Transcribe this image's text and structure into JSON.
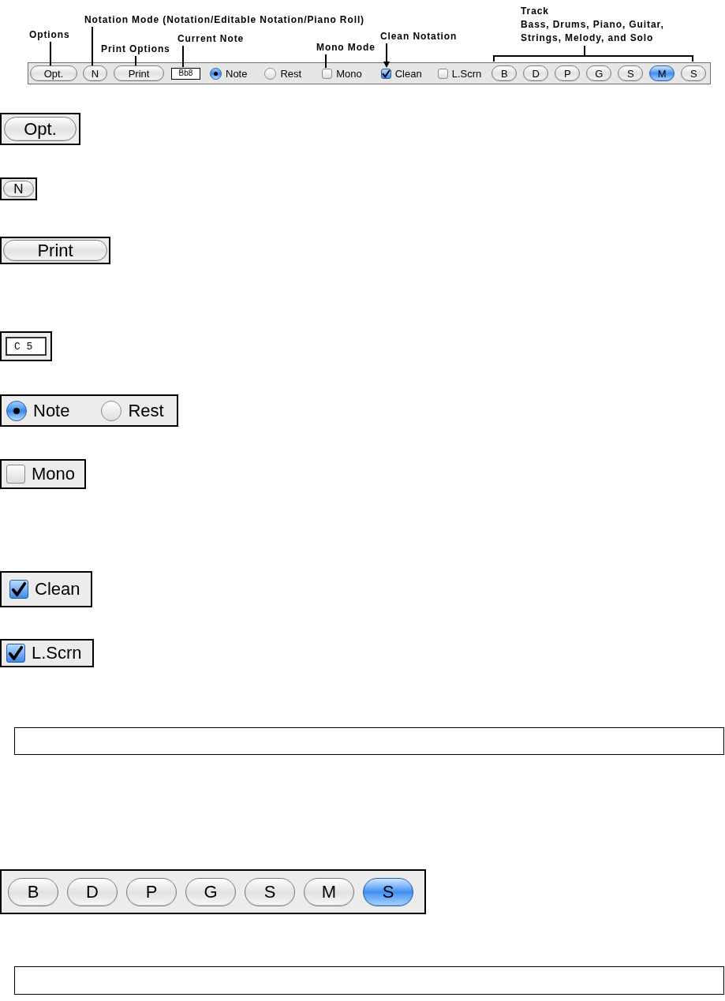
{
  "callouts": [
    {
      "kind": "line",
      "text": "Options"
    },
    {
      "kind": "line",
      "text": "Notation Mode (Notation/Editable Notation/Piano Roll)"
    },
    {
      "kind": "line",
      "text": "Print Options"
    },
    {
      "kind": "line",
      "text": "Current Note"
    },
    {
      "kind": "line",
      "text": "Mono Mode"
    },
    {
      "kind": "arrow",
      "text": "Clean Notation"
    },
    {
      "kind": "bracket",
      "lines": [
        "Track",
        "Bass, Drums, Piano, Guitar,",
        "Strings, Melody, and Solo"
      ]
    }
  ],
  "toolbar": {
    "items": [
      {
        "kind": "button",
        "label": "Opt."
      },
      {
        "kind": "button",
        "label": "N"
      },
      {
        "kind": "button",
        "label": "Print"
      },
      {
        "kind": "field",
        "value": "Bb8"
      },
      {
        "kind": "radio",
        "label": "Note",
        "selected": true
      },
      {
        "kind": "radio",
        "label": "Rest",
        "selected": false
      },
      {
        "kind": "checkbox",
        "label": "Mono",
        "checked": false
      },
      {
        "kind": "checkbox",
        "label": "Clean",
        "checked": true
      },
      {
        "kind": "checkbox",
        "label": "L.Scrn",
        "checked": false
      },
      {
        "kind": "track",
        "label": "B",
        "selected": false
      },
      {
        "kind": "track",
        "label": "D",
        "selected": false
      },
      {
        "kind": "track",
        "label": "P",
        "selected": false
      },
      {
        "kind": "track",
        "label": "G",
        "selected": false
      },
      {
        "kind": "track",
        "label": "S",
        "selected": false
      },
      {
        "kind": "track",
        "label": "M",
        "selected": true
      },
      {
        "kind": "track",
        "label": "S",
        "selected": false
      }
    ]
  },
  "details": [
    {
      "kind": "button",
      "label": "Opt."
    },
    {
      "kind": "button",
      "label": "N"
    },
    {
      "kind": "button",
      "label": "Print"
    },
    {
      "kind": "field",
      "value": "C 5"
    },
    {
      "kind": "radios",
      "options": [
        {
          "label": "Note",
          "selected": true
        },
        {
          "label": "Rest",
          "selected": false
        }
      ]
    },
    {
      "kind": "checkbox",
      "label": "Mono",
      "checked": false
    },
    {
      "kind": "checkbox",
      "label": "Clean",
      "checked": true
    },
    {
      "kind": "checkbox",
      "label": "L.Scrn",
      "checked": true
    },
    {
      "kind": "frame"
    },
    {
      "kind": "tracks",
      "buttons": [
        {
          "label": "B",
          "selected": false
        },
        {
          "label": "D",
          "selected": false
        },
        {
          "label": "P",
          "selected": false
        },
        {
          "label": "G",
          "selected": false
        },
        {
          "label": "S",
          "selected": false
        },
        {
          "label": "M",
          "selected": false
        },
        {
          "label": "S",
          "selected": true
        }
      ]
    },
    {
      "kind": "frame"
    }
  ]
}
